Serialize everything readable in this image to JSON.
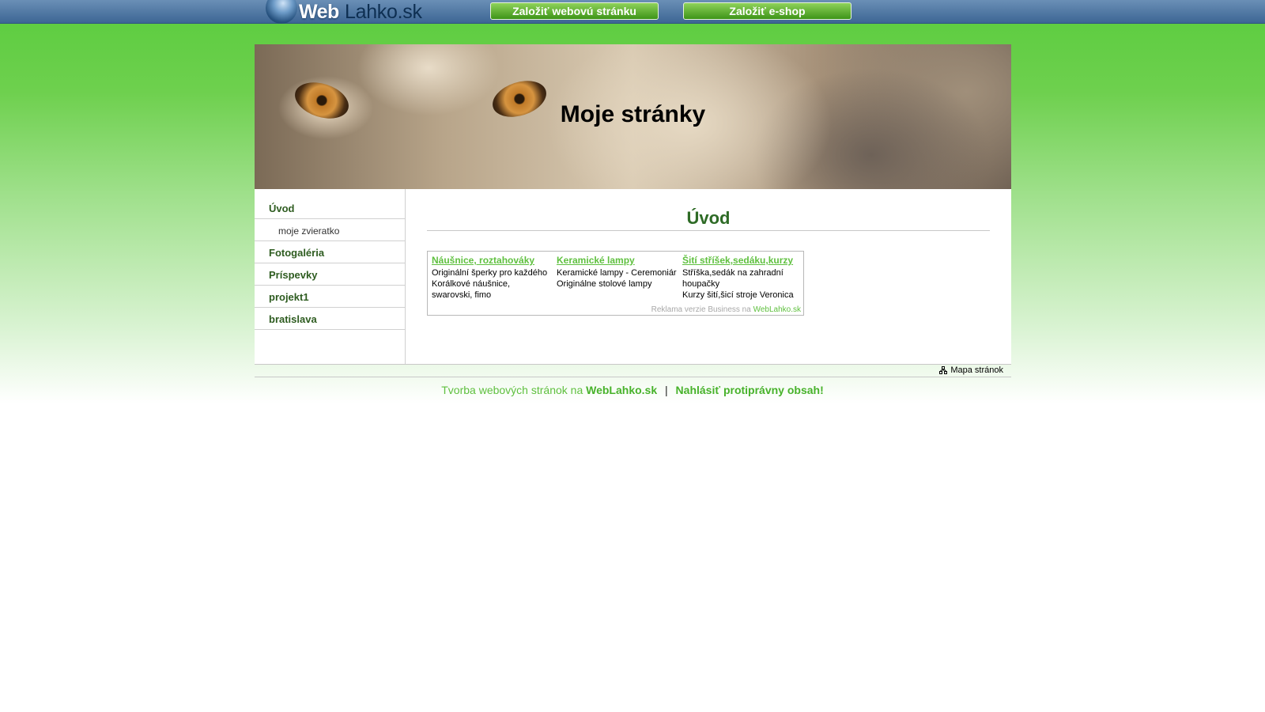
{
  "topbar": {
    "logo_web": "Web",
    "logo_rest": "Lahko.sk",
    "btn_website": "Založiť webovú stránku",
    "btn_eshop": "Založiť e-shop"
  },
  "header": {
    "title": "Moje stránky"
  },
  "sidebar": {
    "items": [
      {
        "label": "Úvod"
      },
      {
        "label": "moje zvieratko"
      },
      {
        "label": "Fotogaléria"
      },
      {
        "label": "Príspevky"
      },
      {
        "label": "projekt1"
      },
      {
        "label": "bratislava"
      }
    ]
  },
  "content": {
    "title": "Úvod",
    "ads": [
      {
        "title": "Náušnice, roztahováky",
        "line1": "Originální šperky pro každého",
        "line2": "Korálkové náušnice, swarovski, fimo"
      },
      {
        "title": "Keramické lampy",
        "line1": "Keramické lampy - Ceremoniár",
        "line2": "Originálne stolové lampy"
      },
      {
        "title": "Šití stříšek,sedáku,kurzy",
        "line1": "Stříška,sedák na zahradní houpačky",
        "line2": "Kurzy šití,šicí stroje Veronica"
      }
    ],
    "ad_footer_text": "Reklama verzie Business na",
    "ad_footer_link": "WebLahko.sk"
  },
  "strip": {
    "sitemap": "Mapa stránok"
  },
  "footer": {
    "text": "Tvorba webových stránok na",
    "brand": "WebLahko.sk",
    "separator": "|",
    "report": "Nahlásiť protiprávny obsah!"
  }
}
